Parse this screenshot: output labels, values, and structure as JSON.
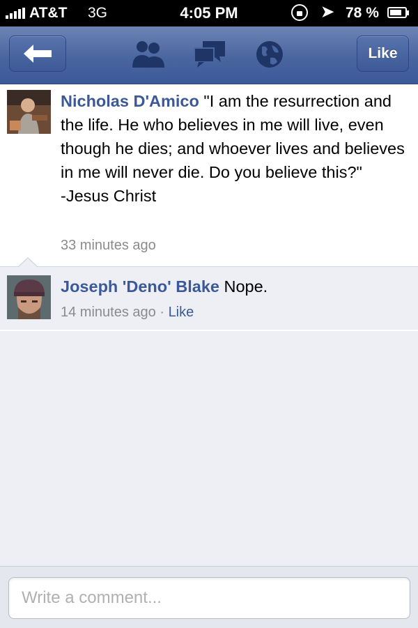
{
  "status_bar": {
    "carrier": "AT&T",
    "network": "3G",
    "time": "4:05 PM",
    "battery_percent": "78 %",
    "battery_level": 0.78,
    "icons": [
      "signal-icon",
      "rotation-lock-icon",
      "location-icon",
      "battery-icon"
    ]
  },
  "nav_bar": {
    "back_icon": "back-arrow-icon",
    "icons": [
      "friend-requests-icon",
      "messages-icon",
      "notifications-globe-icon"
    ],
    "like_label": "Like",
    "color": "#3b5998"
  },
  "post": {
    "author": "Nicholas D'Amico",
    "text": "\"I am the resurrection and the life. He who believes in me will live, even though he dies; and whoever lives and believes in me will never die. Do you believe this?\"\n-Jesus Christ",
    "timestamp": "33 minutes ago"
  },
  "comments": [
    {
      "author": "Joseph 'Deno' Blake",
      "text": "Nope.",
      "timestamp": "14 minutes ago",
      "separator": "·",
      "like_label": "Like"
    }
  ],
  "composer": {
    "placeholder": "Write a comment..."
  }
}
